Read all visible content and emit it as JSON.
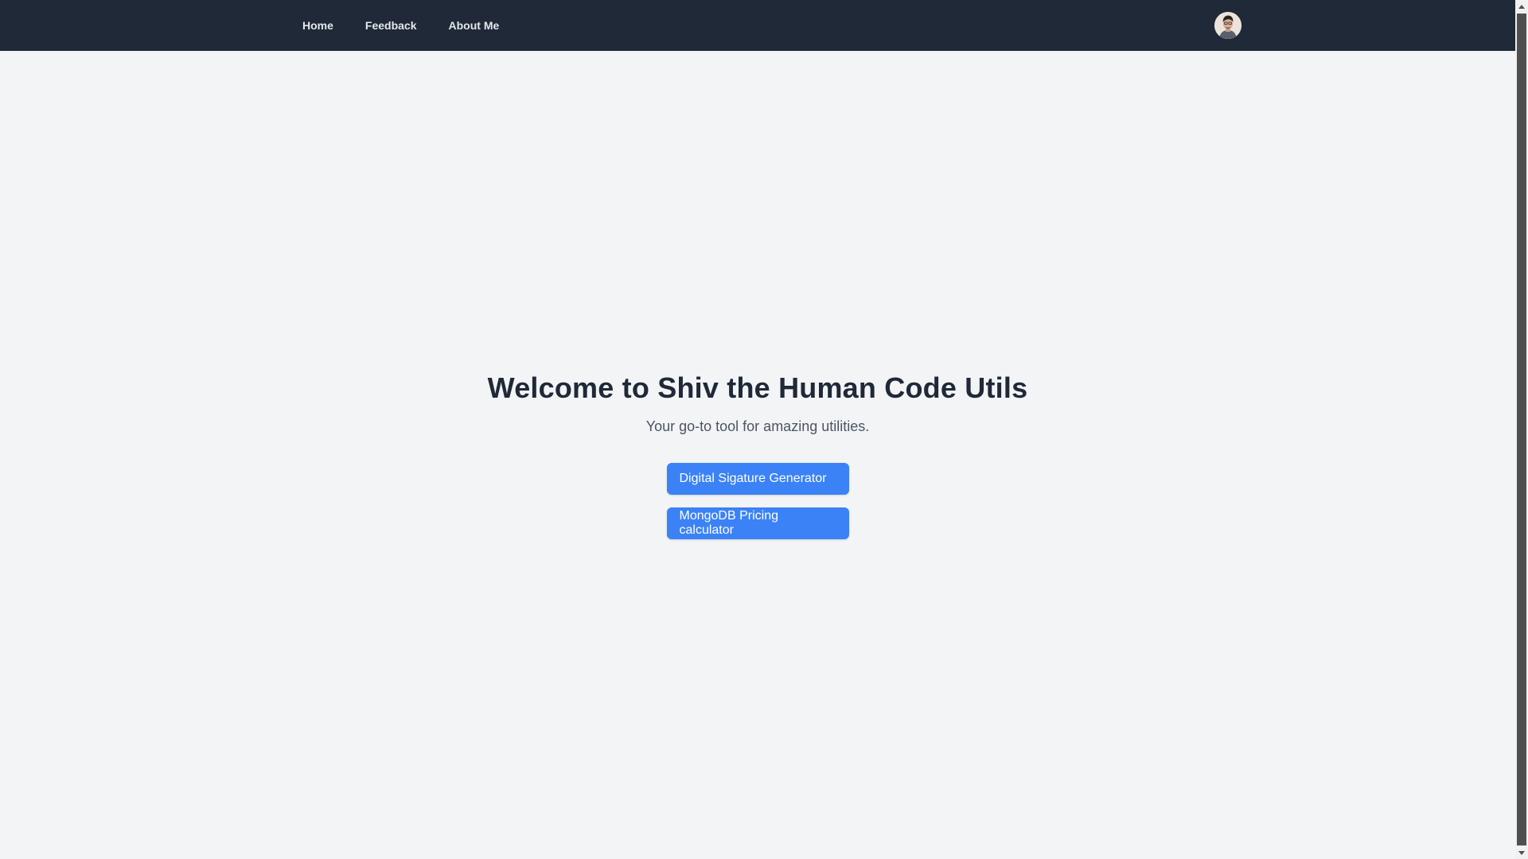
{
  "navbar": {
    "links": [
      "Home",
      "Feedback",
      "About Me"
    ]
  },
  "avatar": {
    "icon": "user-avatar"
  },
  "hero": {
    "title": "Welcome to Shiv the Human Code Utils",
    "subtitle": "Your go-to tool for amazing utilities.",
    "buttons": [
      "Digital Sigature Generator",
      "MongoDB Pricing calculator"
    ]
  },
  "colors": {
    "navbar_bg": "#1f2937",
    "page_bg": "#f3f4f6",
    "accent": "#3b82f6",
    "title_text": "#1f2937",
    "subtitle_text": "#4b5563"
  }
}
